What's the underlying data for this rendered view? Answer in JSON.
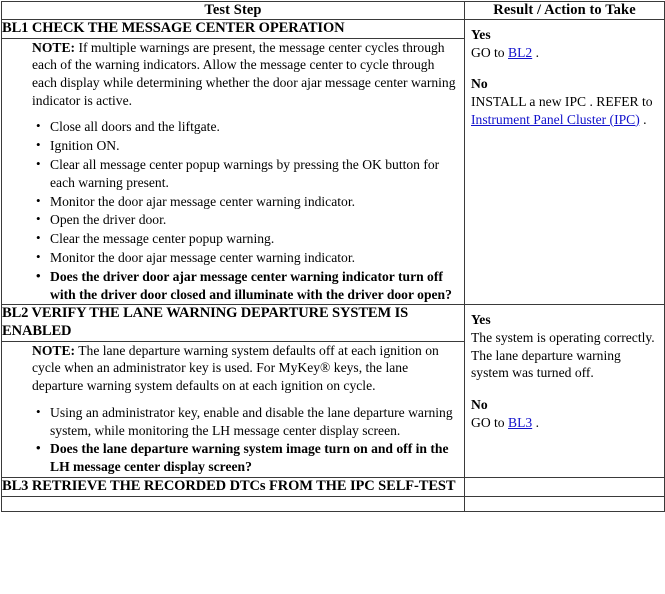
{
  "table": {
    "headers": {
      "test_step": "Test Step",
      "result_action": "Result / Action to Take"
    }
  },
  "steps": [
    {
      "id": "BL1",
      "title": "BL1 CHECK THE MESSAGE CENTER OPERATION",
      "note_label": "NOTE:",
      "note_text": " If multiple warnings are present, the message center cycles through each of the warning indicators. Allow the message center to cycle through each display while determining whether the door ajar message center warning indicator is active.",
      "bullets": [
        "Close all doors and the liftgate.",
        "Ignition ON.",
        "Clear all message center popup warnings by pressing the OK button for each warning present.",
        "Monitor the door ajar message center warning indicator.",
        "Open the driver door.",
        "Clear the message center popup warning.",
        "Monitor the door ajar message center warning indicator."
      ],
      "question": "Does the driver door ajar message center warning indicator turn off with the driver door closed and illuminate with the driver door open?",
      "result": {
        "yes_label": "Yes",
        "yes_text_pre": "GO to ",
        "yes_link": "BL2",
        "yes_text_post": " .",
        "no_label": "No",
        "no_text_pre": "INSTALL a new IPC . REFER to ",
        "no_link": "Instrument Panel Cluster (IPC)",
        "no_text_post": " ."
      }
    },
    {
      "id": "BL2",
      "title": "BL2 VERIFY THE LANE WARNING DEPARTURE SYSTEM IS ENABLED",
      "note_label": "NOTE:",
      "note_text": " The lane departure warning system defaults off at each ignition on cycle when an administrator key is used. For MyKey® keys, the lane departure warning system defaults on at each ignition on cycle.",
      "bullets": [
        "Using an administrator key, enable and disable the lane departure warning system, while monitoring the LH message center display screen."
      ],
      "question": "Does the lane departure warning system image turn on and off in the LH message center display screen?",
      "result": {
        "yes_label": "Yes",
        "yes_text_pre": "The system is operating correctly. The lane departure warning system was turned off.",
        "yes_link": "",
        "yes_text_post": "",
        "no_label": "No",
        "no_text_pre": "GO to ",
        "no_link": "BL3",
        "no_text_post": " ."
      }
    },
    {
      "id": "BL3",
      "title": "BL3 RETRIEVE THE RECORDED DTCs FROM THE IPC SELF-TEST"
    }
  ],
  "colors": {
    "link": "#1111cc",
    "border": "#3a3a3a",
    "text": "#000000",
    "background": "#ffffff"
  }
}
